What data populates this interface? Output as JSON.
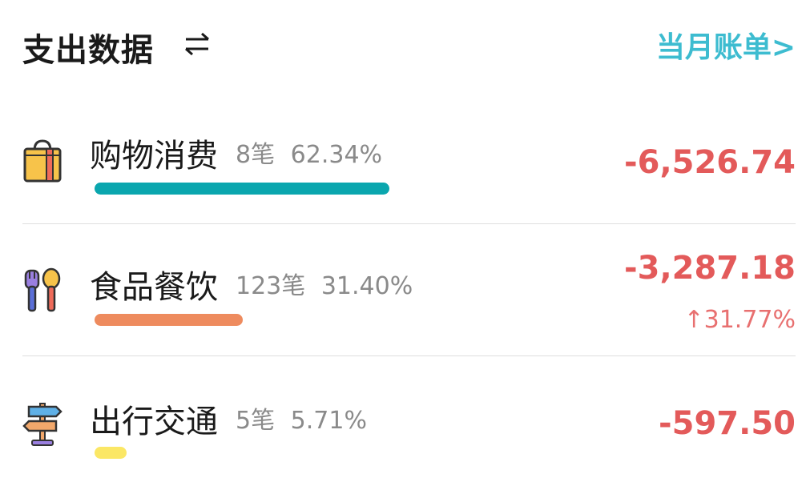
{
  "header": {
    "title": "支出数据",
    "swap_icon": "swap-arrows-icon",
    "monthly_link": "当月账单>"
  },
  "categories": [
    {
      "name": "购物消费",
      "count": "8笔",
      "percent": "62.34%",
      "amount": "-6,526.74",
      "bar_fraction": 0.6234,
      "bar_color": "#0aa6ae",
      "icon": "shopping-bag-icon"
    },
    {
      "name": "食品餐饮",
      "count": "123笔",
      "percent": "31.40%",
      "amount": "-3,287.18",
      "change": "↑31.77%",
      "bar_fraction": 0.314,
      "bar_color": "#ee8b5e",
      "icon": "fork-spoon-icon"
    },
    {
      "name": "出行交通",
      "count": "5笔",
      "percent": "5.71%",
      "amount": "-597.50",
      "bar_fraction": 0.0571,
      "bar_color": "#fbe765",
      "icon": "signpost-icon"
    }
  ],
  "colors": {
    "accent": "#3dbcd0",
    "expense": "#e35a5a",
    "muted": "#8a8a8a"
  }
}
